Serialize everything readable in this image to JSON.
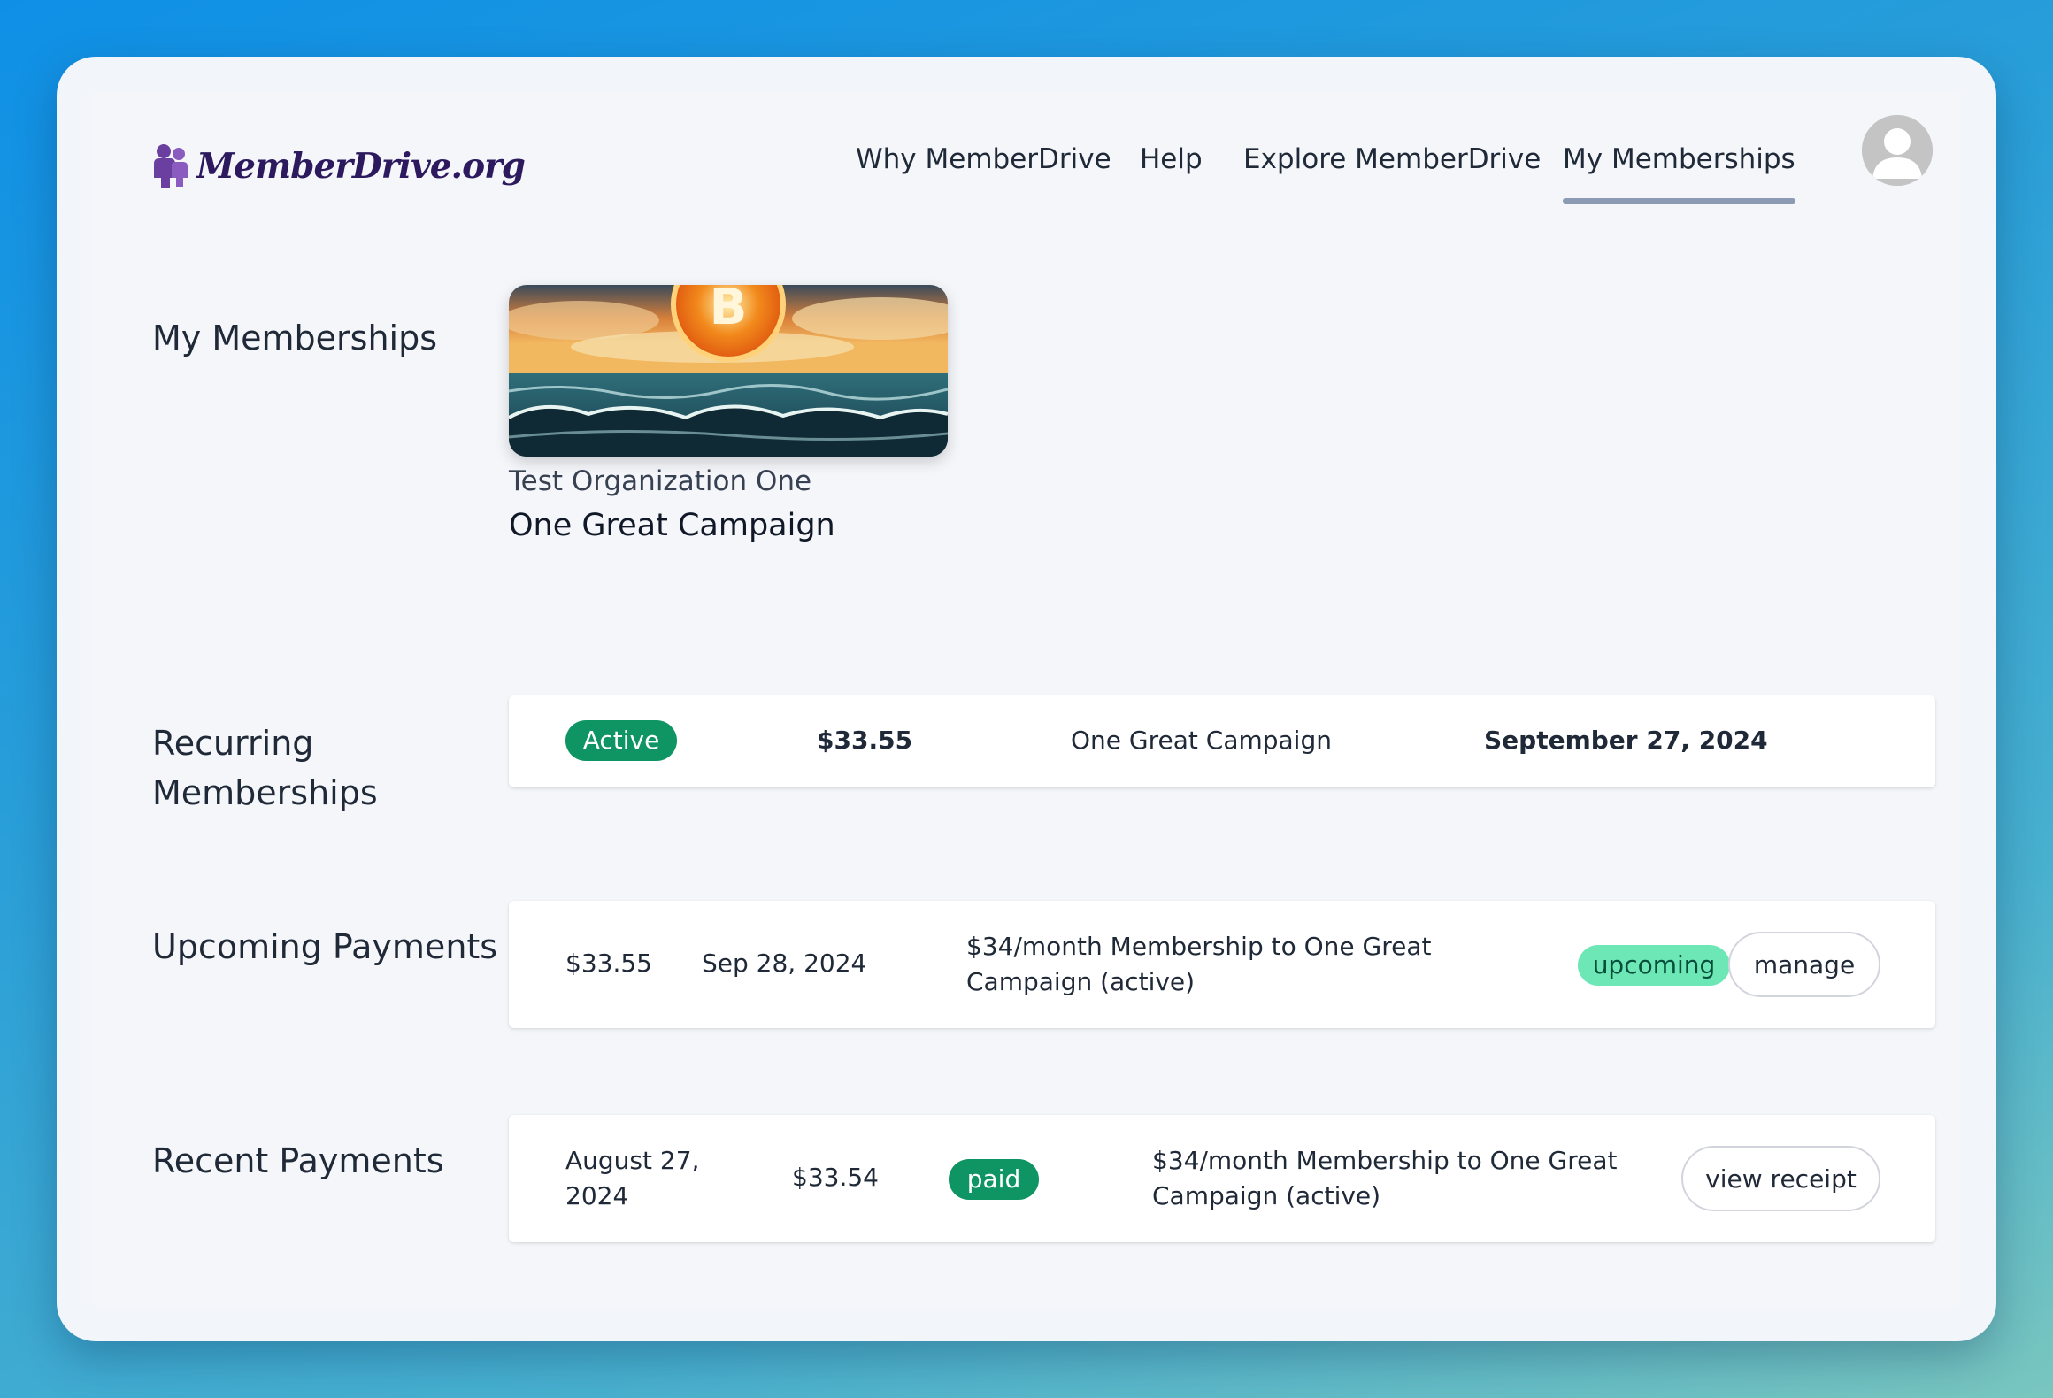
{
  "header": {
    "logo_text": "MemberDrive.org",
    "nav": [
      {
        "label": "Why MemberDrive"
      },
      {
        "label": "Help"
      },
      {
        "label": "Explore MemberDrive"
      },
      {
        "label": "My Memberships",
        "active": true
      }
    ]
  },
  "memberships": {
    "label": "My Memberships",
    "card": {
      "organization": "Test Organization One",
      "campaign": "One Great Campaign"
    }
  },
  "recurring": {
    "label": "Recurring Memberships",
    "row": {
      "status": "Active",
      "amount": "$33.55",
      "campaign": "One Great Campaign",
      "date": "September 27, 2024"
    }
  },
  "upcoming": {
    "label": "Upcoming Payments",
    "row": {
      "amount": "$33.55",
      "date": "Sep 28, 2024",
      "description": "$34/month Membership to One Great Campaign (active)",
      "status": "upcoming",
      "action": "manage"
    }
  },
  "recent": {
    "label": "Recent Payments",
    "row": {
      "date": "August 27, 2024",
      "amount": "$33.54",
      "status": "paid",
      "description": "$34/month Membership to One Great Campaign (active)",
      "action": "view receipt"
    }
  },
  "colors": {
    "brand": "#2d1a5e",
    "logo_icon": "#6b3fa0",
    "status_active": "#0f9463",
    "status_upcoming": "#6ee7b7",
    "nav_underline": "#8a9bb3"
  },
  "icons": {
    "logo": "people-logo-icon",
    "avatar": "user-avatar-icon"
  }
}
